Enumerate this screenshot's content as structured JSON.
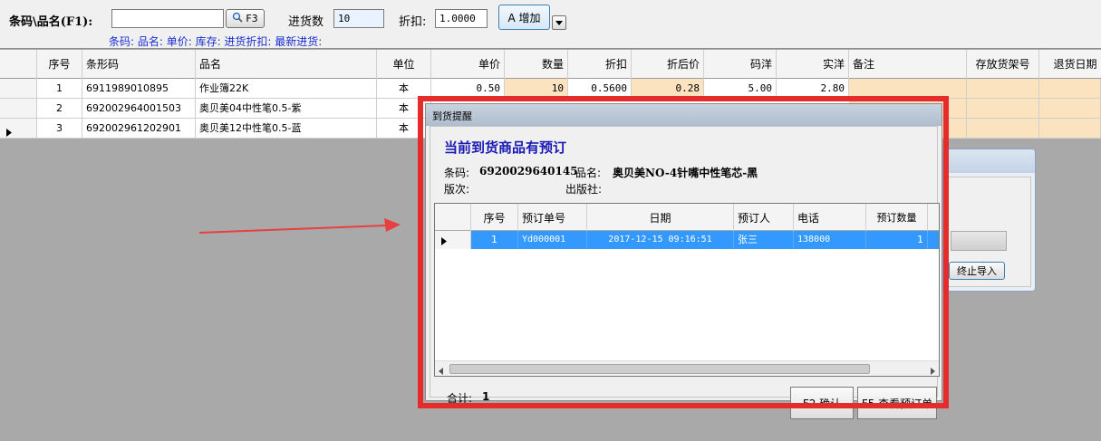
{
  "toolbar": {
    "barcode_label": "条码\\品名(F1):",
    "barcode_value": "",
    "search_btn_label": "F3",
    "qty_label": "进货数",
    "qty_value": "10",
    "discount_label": "折扣:",
    "discount_value": "1.0000",
    "add_btn_label": "A 增加",
    "info_line": "条码: 品名: 单价: 库存: 进货折扣: 最新进货:"
  },
  "grid": {
    "columns": [
      "序号",
      "条形码",
      "品名",
      "单位",
      "单价",
      "数量",
      "折扣",
      "折后价",
      "码洋",
      "实洋",
      "备注",
      "存放货架号",
      "退货日期"
    ],
    "rows": [
      {
        "no": "1",
        "barcode": "6911989010895",
        "name": "作业簿22K",
        "unit": "本",
        "price": "0.50",
        "qty": "10",
        "discount": "0.5600",
        "net_price": "0.28",
        "list_total": "5.00",
        "net_total": "2.80"
      },
      {
        "no": "2",
        "barcode": "692002964001503",
        "name": "奥贝美04中性笔0.5-紫",
        "unit": "本"
      },
      {
        "no": "3",
        "barcode": "692002961202901",
        "name": "奥贝美12中性笔0.5-蓝",
        "unit": "本",
        "current": true
      }
    ]
  },
  "bg_dialog": {
    "stop_button": "终止导入"
  },
  "modal": {
    "window_title": "到货提醒",
    "heading": "当前到货商品有预订",
    "barcode_label": "条码:",
    "barcode_value": "6920029640145",
    "name_label": "品名:",
    "name_value": "奥贝美NO-4针嘴中性笔芯-黑",
    "edition_label": "版次:",
    "publisher_label": "出版社:",
    "columns": [
      "序号",
      "预订单号",
      "日期",
      "预订人",
      "电话",
      "预订数量"
    ],
    "rows": [
      {
        "no": "1",
        "order_no": "Yd000001",
        "date": "2017-12-15 09:16:51",
        "person": "张三",
        "phone": "138000",
        "qty": "1"
      }
    ],
    "total_label": "合计:",
    "total_value": "1",
    "confirm_button": "F2 确认",
    "view_orders_button": "F5 查看预订单"
  },
  "colors": {
    "highlight_frame": "#e62b2b",
    "arrow": "#e84040",
    "selection": "#3399ff",
    "editable_cell": "#fbe3c0",
    "info_text": "#1b2fd0",
    "heading_text": "#1a1ab5"
  }
}
